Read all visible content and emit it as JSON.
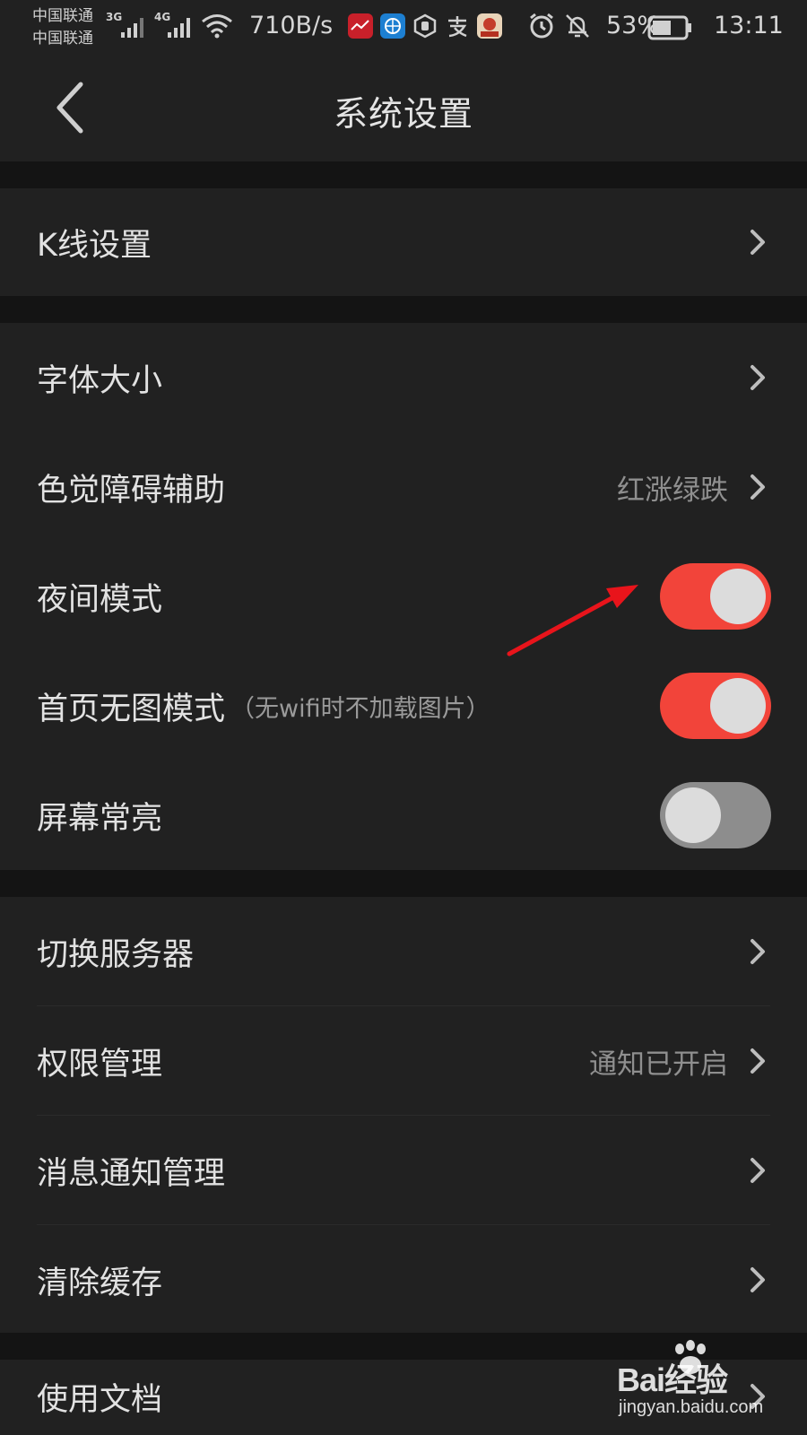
{
  "status_bar": {
    "carrier_1": "中国联通",
    "carrier_2": "中国联通",
    "network_1": "3G",
    "network_2": "4G",
    "net_speed": "710B/s",
    "battery_percent": "53%",
    "time": "13:11",
    "icons": [
      "signal-icon",
      "wifi-icon",
      "app-notification-icon",
      "alarm-icon",
      "mute-icon",
      "battery-icon"
    ]
  },
  "header": {
    "title": "系统设置",
    "back_icon": "chevron-left-icon"
  },
  "settings": {
    "kline": {
      "label": "K线设置"
    },
    "font_size": {
      "label": "字体大小"
    },
    "color_assist": {
      "label": "色觉障碍辅助",
      "value": "红涨绿跌"
    },
    "night_mode": {
      "label": "夜间模式",
      "enabled": true
    },
    "no_image": {
      "label": "首页无图模式",
      "hint": "（无wifi时不加载图片）",
      "enabled": true
    },
    "screen_on": {
      "label": "屏幕常亮",
      "enabled": false
    },
    "switch_server": {
      "label": "切换服务器"
    },
    "permissions": {
      "label": "权限管理",
      "value": "通知已开启"
    },
    "notifications": {
      "label": "消息通知管理"
    },
    "clear_cache": {
      "label": "清除缓存"
    },
    "docs": {
      "label": "使用文档"
    }
  },
  "colors": {
    "background": "#141414",
    "panel": "#212121",
    "toggle_on": "#f2443a",
    "toggle_off": "#8d8d8d",
    "annotation_arrow": "#e8141b"
  },
  "watermark": {
    "logo": "Bai经验",
    "url": "jingyan.baidu.com"
  }
}
